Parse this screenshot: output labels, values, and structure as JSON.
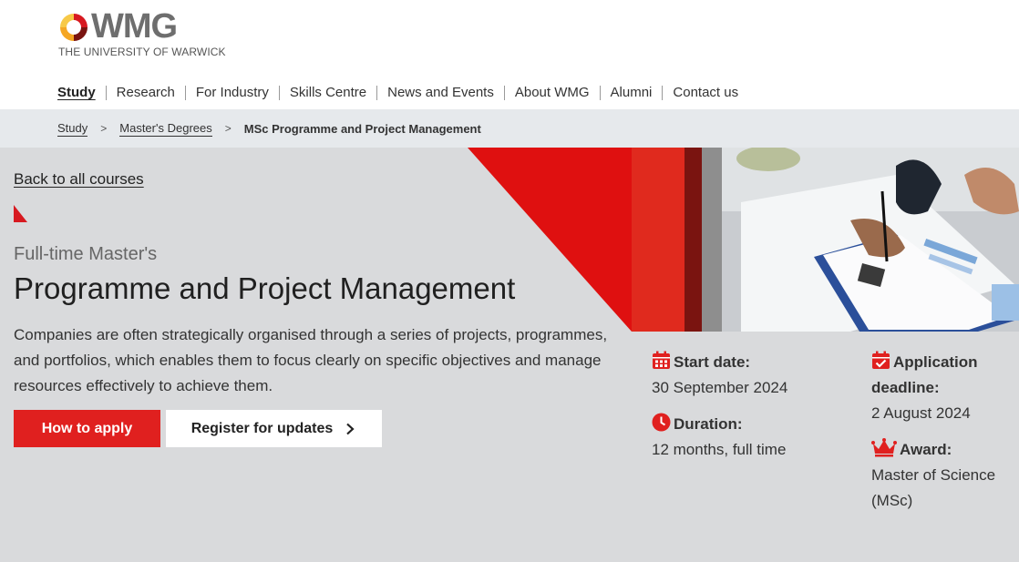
{
  "header": {
    "logo_word": "WMG",
    "logo_sub": "THE UNIVERSITY OF WARWICK"
  },
  "nav": {
    "items": [
      {
        "label": "Study",
        "active": true
      },
      {
        "label": "Research"
      },
      {
        "label": "For Industry"
      },
      {
        "label": "Skills Centre"
      },
      {
        "label": "News and Events"
      },
      {
        "label": "About WMG"
      },
      {
        "label": "Alumni"
      },
      {
        "label": "Contact us"
      }
    ]
  },
  "breadcrumb": {
    "items": [
      "Study",
      "Master's Degrees"
    ],
    "separator": ">",
    "current": "MSc Programme and Project Management"
  },
  "hero": {
    "back_link": "Back to all courses",
    "kicker": "Full-time Master's",
    "title": "Programme and Project Management",
    "description": "Companies are often strategically organised through a series of projects, programmes, and portfolios, which enables them to focus clearly on specific objectives and manage resources effectively to achieve them.",
    "apply_label": "How to apply",
    "register_label": "Register for updates"
  },
  "info": {
    "start_label": "Start date:",
    "start_value": "30 September 2024",
    "duration_label": "Duration:",
    "duration_value": "12 months, full time",
    "deadline_label_1": "Application",
    "deadline_label_2": "deadline:",
    "deadline_value": "2 August 2024",
    "award_label": "Award:",
    "award_value_1": "Master of Science",
    "award_value_2": "(MSc)"
  },
  "colors": {
    "accent_red": "#e0201f",
    "dark_red": "#7a1410",
    "hero_bg": "#d9dadc",
    "breadcrumb_bg": "#e6e9ec"
  },
  "icons": {
    "start": "calendar-icon",
    "duration": "clock-icon",
    "deadline": "calendar-check-icon",
    "award": "crown-icon",
    "register": "chevron-right-icon"
  }
}
